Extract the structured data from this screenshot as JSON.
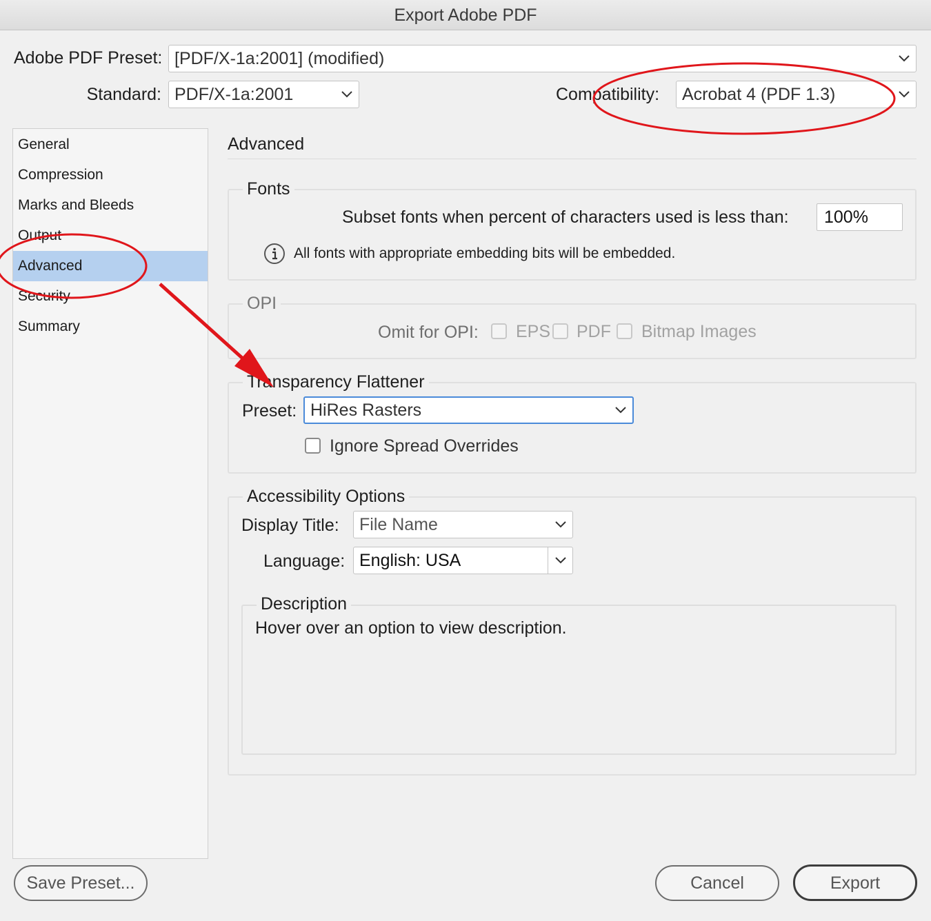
{
  "window": {
    "title": "Export Adobe PDF"
  },
  "preset": {
    "label": "Adobe PDF Preset:",
    "value": "[PDF/X-1a:2001] (modified)"
  },
  "standard": {
    "label": "Standard:",
    "value": "PDF/X-1a:2001"
  },
  "compatibility": {
    "label": "Compatibility:",
    "value": "Acrobat 4 (PDF 1.3)"
  },
  "sidebar": {
    "items": [
      {
        "label": "General"
      },
      {
        "label": "Compression"
      },
      {
        "label": "Marks and Bleeds"
      },
      {
        "label": "Output"
      },
      {
        "label": "Advanced"
      },
      {
        "label": "Security"
      },
      {
        "label": "Summary"
      }
    ],
    "selected": "Advanced"
  },
  "main": {
    "heading": "Advanced",
    "fonts": {
      "legend": "Fonts",
      "subset_label": "Subset fonts when percent of characters used is less than:",
      "subset_value": "100%",
      "info_text": "All fonts with appropriate embedding bits will be embedded."
    },
    "opi": {
      "legend": "OPI",
      "omit_label": "Omit for OPI:",
      "options": [
        "EPS",
        "PDF",
        "Bitmap Images"
      ]
    },
    "flattener": {
      "legend": "Transparency Flattener",
      "preset_label": "Preset:",
      "preset_value": "HiRes Rasters",
      "ignore_label": "Ignore Spread Overrides"
    },
    "accessibility": {
      "legend": "Accessibility Options",
      "display_title_label": "Display Title:",
      "display_title_value": "File Name",
      "language_label": "Language:",
      "language_value": "English: USA"
    },
    "description": {
      "legend": "Description",
      "text": "Hover over an option to view description."
    }
  },
  "buttons": {
    "save_preset": "Save Preset...",
    "cancel": "Cancel",
    "export": "Export"
  },
  "annotations": {
    "color": "#e0161b"
  }
}
